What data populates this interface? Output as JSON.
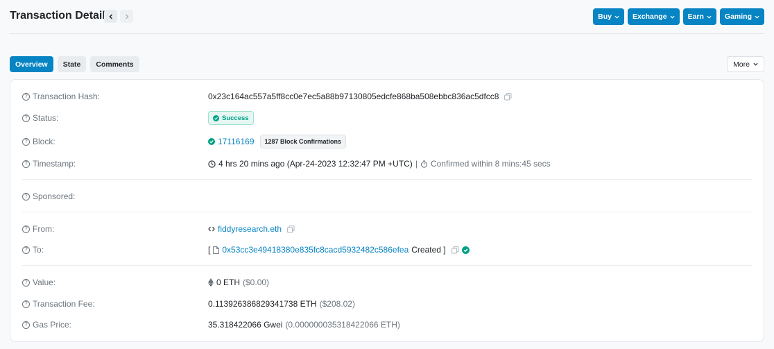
{
  "header": {
    "title": "Transaction Details",
    "buttons": [
      "Buy",
      "Exchange",
      "Earn",
      "Gaming"
    ]
  },
  "tabs": [
    "Overview",
    "State",
    "Comments"
  ],
  "more_label": "More",
  "colors": {
    "accent": "#0784c3",
    "success": "#00a186"
  },
  "fields": {
    "tx_hash": {
      "label": "Transaction Hash:",
      "value": "0x23c164ac557a5ff8cc0e7ec5a88b97130805edcfe868ba508ebbc836ac5dfcc8"
    },
    "status": {
      "label": "Status:",
      "value": "Success"
    },
    "block": {
      "label": "Block:",
      "value": "17116169",
      "confirmations": "1287 Block Confirmations"
    },
    "timestamp": {
      "label": "Timestamp:",
      "value": "4 hrs 20 mins ago (Apr-24-2023 12:32:47 PM +UTC)",
      "separator": "|",
      "confirmed": "Confirmed within 8 mins:45 secs"
    },
    "sponsored": {
      "label": "Sponsored:"
    },
    "from": {
      "label": "From:",
      "value": "fiddyresearch.eth"
    },
    "to": {
      "label": "To:",
      "open_bracket": "[",
      "address": "0x53cc3e49418380e835fc8cacd5932482c586efea",
      "created": "Created ]"
    },
    "value": {
      "label": "Value:",
      "amount": "0 ETH",
      "usd": "($0.00)"
    },
    "fee": {
      "label": "Transaction Fee:",
      "amount": "0.113926386829341738 ETH",
      "usd": "($208.02)"
    },
    "gas": {
      "label": "Gas Price:",
      "amount": "35.318422066 Gwei",
      "eth": "(0.000000035318422066 ETH)"
    }
  }
}
